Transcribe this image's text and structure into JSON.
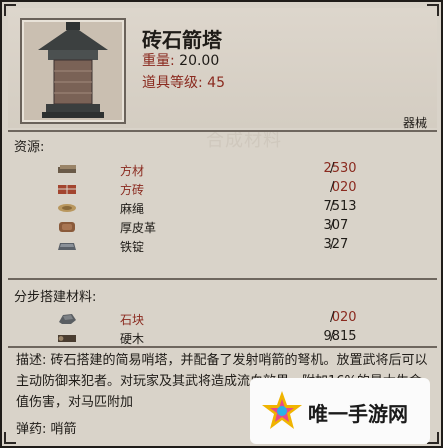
{
  "item": {
    "name": "砖石箭塔",
    "weight_label": "重量:",
    "weight_value": "20.00",
    "level_label": "道具等级:",
    "level_value": "45",
    "category": "器械",
    "watermark": "合成材料"
  },
  "resources": {
    "title": "资源:",
    "items": [
      {
        "name": "方材",
        "have": "25",
        "need": "30",
        "insufficient": true,
        "icon": "timber-icon"
      },
      {
        "name": "方砖",
        "have": "0",
        "need": "20",
        "insufficient": true,
        "icon": "brick-icon"
      },
      {
        "name": "麻绳",
        "have": "75",
        "need": "13",
        "insufficient": false,
        "icon": "rope-icon"
      },
      {
        "name": "厚皮革",
        "have": "30",
        "need": "7",
        "insufficient": false,
        "icon": "leather-icon"
      },
      {
        "name": "铁锭",
        "have": "32",
        "need": "7",
        "insufficient": false,
        "icon": "iron-ingot-icon"
      }
    ]
  },
  "build_materials": {
    "title": "分步搭建材料:",
    "items": [
      {
        "name": "石块",
        "have": "0",
        "need": "20",
        "insufficient": true,
        "icon": "stone-icon"
      },
      {
        "name": "硬木",
        "have": "98",
        "need": "15",
        "insufficient": false,
        "icon": "hardwood-icon"
      }
    ]
  },
  "description": {
    "label": "描述:",
    "text": "砖石搭建的简易哨塔，并配备了发射哨箭的弩机。放置武将后可以主动防御来犯者。对玩家及其武将造成流血效果，附加16%的最大生命值伤害，对马匹附加"
  },
  "ammo": {
    "label": "弹药:",
    "value": "哨箭"
  },
  "ad": {
    "text": "唯一手游网"
  },
  "colors": {
    "red": "#8a2a1f",
    "dark": "#1f1c18",
    "panel": "#d9d3c9"
  }
}
